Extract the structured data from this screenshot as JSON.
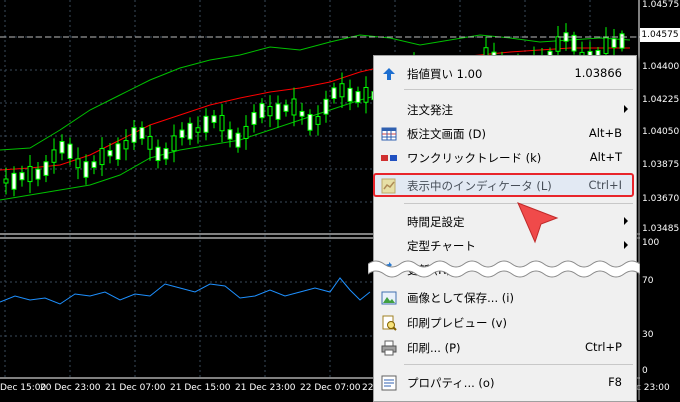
{
  "price_axis": {
    "current": "1.04575",
    "marked": "1.04575",
    "ticks": [
      "1.04400",
      "1.04225",
      "1.04050",
      "1.03875",
      "1.03670",
      "1.03485"
    ]
  },
  "indicator_axis": {
    "ticks": [
      "100",
      "70",
      "30",
      "0"
    ]
  },
  "time_axis": [
    "Dec 15:00",
    "20 Dec 23:00",
    "21 Dec 07:00",
    "21 Dec 15:00",
    "21 Dec 23:00",
    "22 Dec 07:00",
    "22",
    "c 23:00"
  ],
  "context_menu": {
    "buy_limit": {
      "label": "指値買い 1.00",
      "shortcut": "1.03866",
      "icon": "up-arrow-icon"
    },
    "new_order": {
      "label": "注文発注"
    },
    "depth_of_market": {
      "label": "板注文画面 (D)",
      "shortcut": "Alt+B",
      "icon": "grid-icon"
    },
    "one_click": {
      "label": "ワンクリックトレード (k)",
      "shortcut": "Alt+T",
      "icon": "one-click-icon"
    },
    "show_indicators": {
      "label": "表示中のインディケータ (L)",
      "shortcut": "Ctrl+I",
      "icon": "indicator-list-icon"
    },
    "timeframes": {
      "label": "時間足設定"
    },
    "templates": {
      "label": "定型チャート"
    },
    "refresh": {
      "label": "更新 (R)",
      "icon": "refresh-icon"
    },
    "save_image": {
      "label": "画像として保存... (i)",
      "icon": "image-icon"
    },
    "print_preview": {
      "label": "印刷プレビュー (v)",
      "icon": "print-preview-icon"
    },
    "print": {
      "label": "印刷... (P)",
      "shortcut": "Ctrl+P",
      "icon": "printer-icon"
    },
    "properties": {
      "label": "プロパティ... (o)",
      "shortcut": "F8",
      "icon": "properties-icon"
    }
  },
  "colors": {
    "background": "#000000",
    "candle": "#00ff00",
    "bands": "#00c000",
    "moving_average": "#ff0000",
    "indicator_line": "#1e90ff",
    "grid": "#3a4a5a",
    "highlight": "#e8242b",
    "cursor": "#f04a4a"
  }
}
